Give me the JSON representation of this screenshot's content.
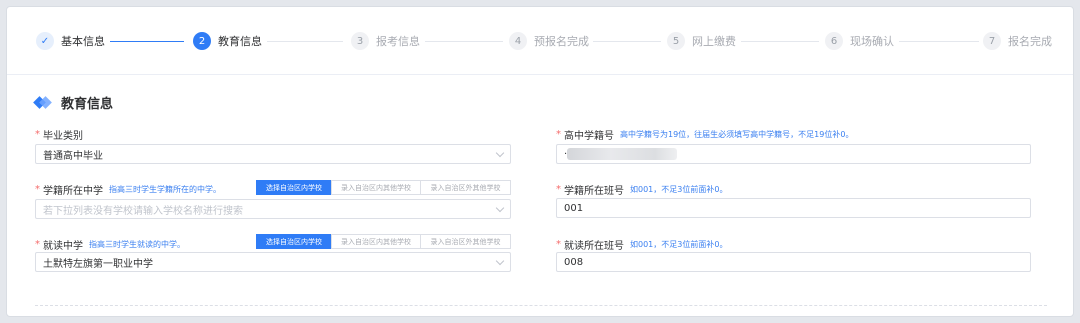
{
  "steps": [
    {
      "num": "✓",
      "label": "基本信息",
      "state": "done"
    },
    {
      "num": "2",
      "label": "教育信息",
      "state": "active"
    },
    {
      "num": "3",
      "label": "报考信息",
      "state": "todo"
    },
    {
      "num": "4",
      "label": "预报名完成",
      "state": "todo"
    },
    {
      "num": "5",
      "label": "网上缴费",
      "state": "todo"
    },
    {
      "num": "6",
      "label": "现场确认",
      "state": "todo"
    },
    {
      "num": "7",
      "label": "报名完成",
      "state": "todo"
    }
  ],
  "section": {
    "title": "教育信息"
  },
  "form": {
    "required_mark": "*",
    "grad_type": {
      "label": "毕业类别",
      "value": "普通高中毕业"
    },
    "reg_school": {
      "label": "学籍所在中学",
      "hint": "指高三时学生学籍所在的中学。",
      "placeholder": "若下拉列表没有学校请输入学校名称进行搜索",
      "options": [
        "选择自治区内学校",
        "录入自治区内其他学校",
        "录入自治区外其他学校"
      ]
    },
    "cur_school": {
      "label": "就读中学",
      "hint": "指高三时学生就读的中学。",
      "value": "土默特左旗第一职业中学",
      "options": [
        "选择自治区内学校",
        "录入自治区内其他学校",
        "录入自治区外其他学校"
      ]
    },
    "hs_reg_no": {
      "label": "高中学籍号",
      "hint": "高中学籍号为19位，往届生必须填写高中学籍号，不足19位补0。",
      "value": "·"
    },
    "reg_class": {
      "label": "学籍所在班号",
      "hint": "如001，不足3位前面补0。",
      "value": "001"
    },
    "cur_class": {
      "label": "就读所在班号",
      "hint": "如001，不足3位前面补0。",
      "value": "008"
    }
  }
}
